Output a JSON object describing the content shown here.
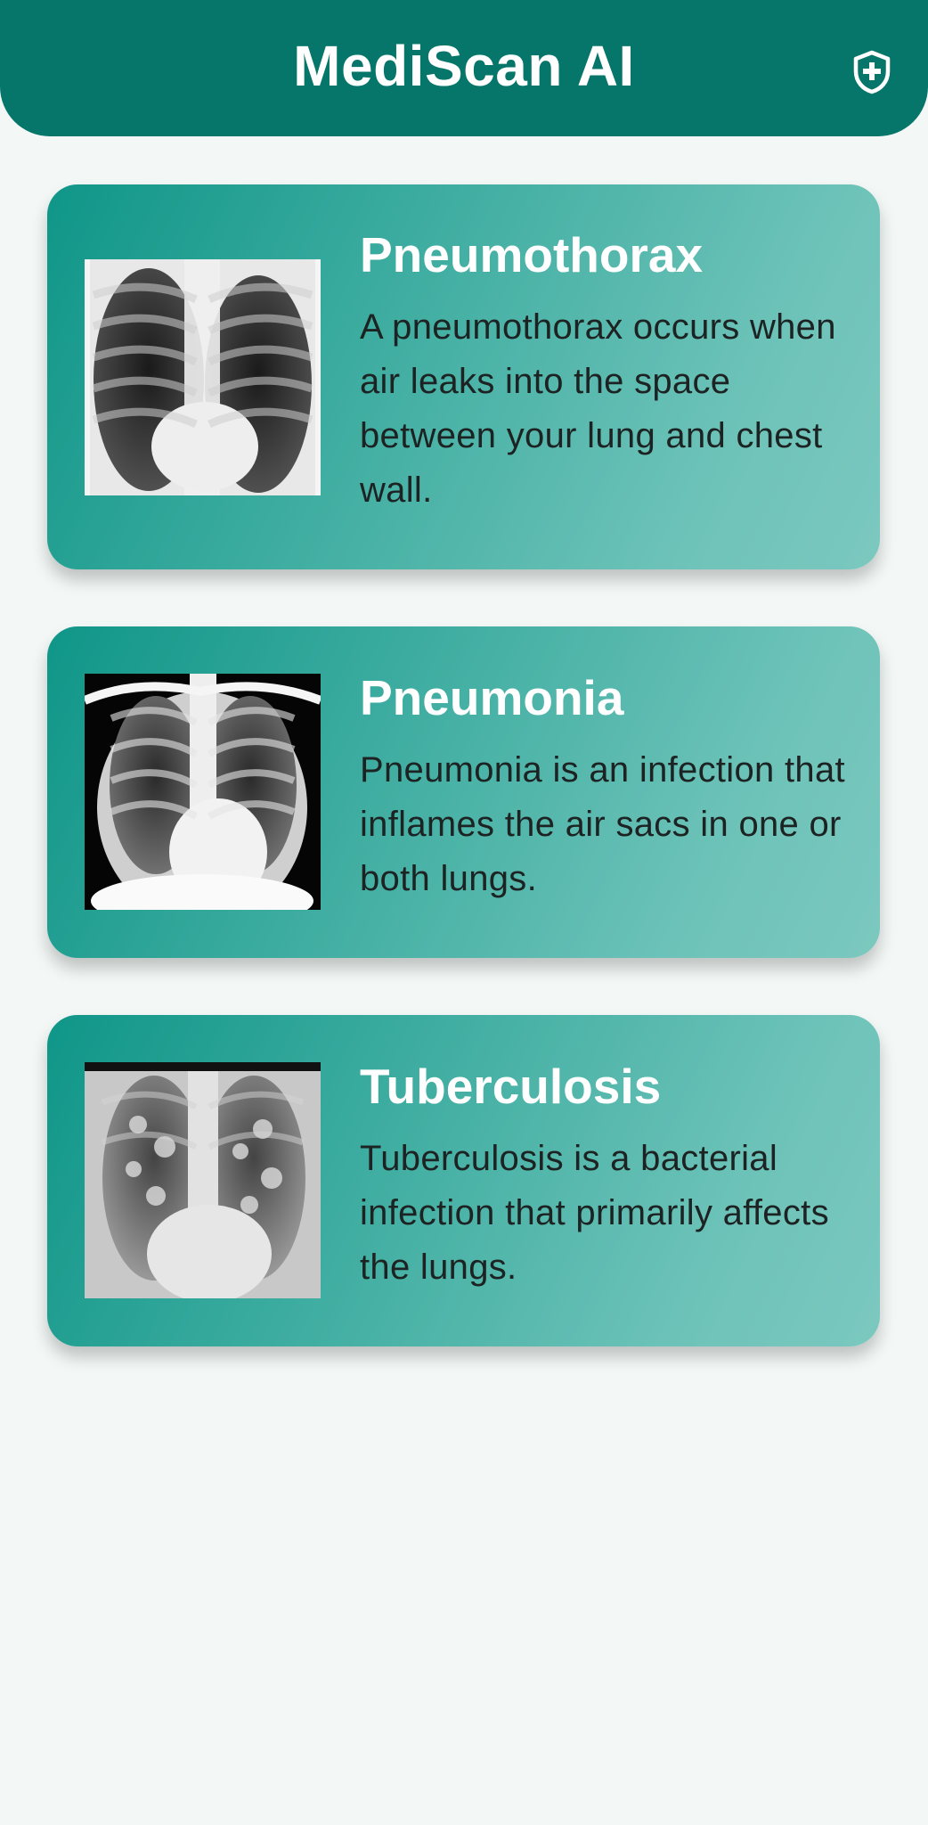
{
  "header": {
    "title": "MediScan AI",
    "action_icon": "shield-plus-icon"
  },
  "colors": {
    "app_bar": "#06766a",
    "background": "#f3f8f6",
    "card_gradient_start": "#0f9688",
    "card_gradient_end": "#7bc8bf"
  },
  "cards": [
    {
      "title": "Pneumothorax",
      "description": "A pneumothorax occurs when air leaks into the space between your lung and chest wall.",
      "image": "chest-xray-pneumothorax"
    },
    {
      "title": "Pneumonia",
      "description": "Pneumonia is an infection that inflames the air sacs in one or both lungs.",
      "image": "chest-xray-pneumonia"
    },
    {
      "title": "Tuberculosis",
      "description": "Tuberculosis is a bacterial infection that primarily affects the lungs.",
      "image": "chest-xray-tuberculosis"
    }
  ]
}
